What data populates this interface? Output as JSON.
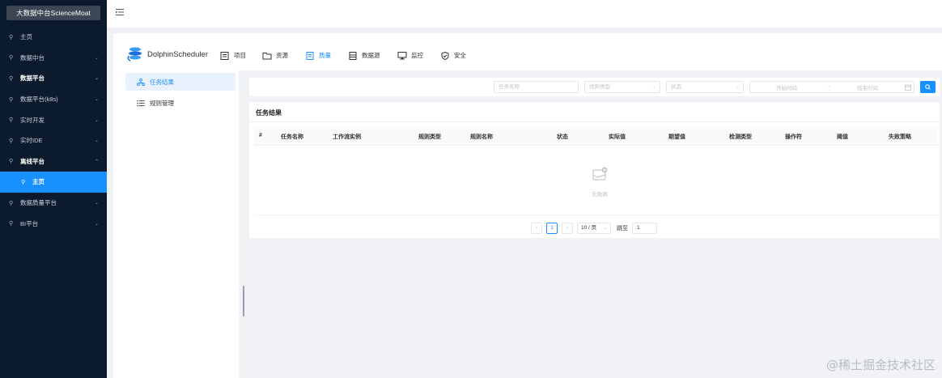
{
  "sidebar": {
    "brand": "大数据中台ScienceMoat",
    "items": [
      {
        "label": "主页",
        "chevron": ""
      },
      {
        "label": "数据中台",
        "chevron": "⌄"
      },
      {
        "label": "数据平台",
        "chevron": "⌄"
      },
      {
        "label": "数据平台(k8s)",
        "chevron": "⌄"
      },
      {
        "label": "实时开发",
        "chevron": "⌄"
      },
      {
        "label": "实时IDE",
        "chevron": "⌄"
      },
      {
        "label": "离线平台",
        "chevron": "⌃"
      },
      {
        "label": "主页",
        "chevron": ""
      },
      {
        "label": "数据质量平台",
        "chevron": "⌄"
      },
      {
        "label": "BI平台",
        "chevron": "⌄"
      }
    ]
  },
  "ds": {
    "logo_text": "DolphinScheduler",
    "nav": {
      "project": "项目",
      "resource": "资源",
      "quality": "质量",
      "datasource": "数据源",
      "monitor": "监控",
      "security": "安全"
    },
    "side": {
      "task_result": "任务结果",
      "rule_manage": "规则管理"
    }
  },
  "filter": {
    "task_name_placeholder": "任务名称",
    "rule_type_placeholder": "规则类型",
    "status_placeholder": "状态",
    "start_time_placeholder": "开始时间",
    "range_sep": "→",
    "end_time_placeholder": "结束时间"
  },
  "card": {
    "title": "任务结果",
    "columns": [
      "#",
      "任务名称",
      "工作流实例",
      "规则类型",
      "规则名称",
      "状态",
      "实际值",
      "期望值",
      "检测类型",
      "操作符",
      "阈值",
      "失败策略"
    ],
    "empty_text": "无数据"
  },
  "pager": {
    "prev": "‹",
    "current_page": "1",
    "next": "›",
    "page_size": "10 / 页",
    "jump_label": "跳至",
    "jump_value": "1"
  },
  "watermark": "@稀土掘金技术社区",
  "colors": {
    "accent": "#1890ff",
    "sidebar_bg": "#0c1a2d",
    "active_menu": "#1890ff"
  }
}
